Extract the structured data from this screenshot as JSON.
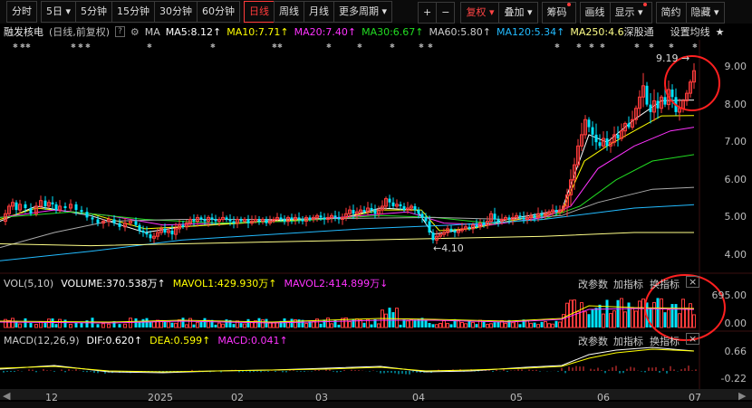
{
  "toolbar": {
    "periods": [
      "分时",
      "5日",
      "5分钟",
      "15分钟",
      "30分钟",
      "60分钟",
      "日线",
      "周线",
      "月线",
      "更多周期"
    ],
    "active": "日线",
    "right": [
      "+",
      "−",
      "复权",
      "叠加",
      "筹码",
      "画线",
      "显示",
      "简约",
      "隐藏"
    ]
  },
  "info": {
    "name": "融发核电",
    "mode": "(日线,前复权)",
    "help": "?",
    "ma_label": "MA",
    "ma5": "MA5:8.12↑",
    "ma10": "MA10:7.71↑",
    "ma20": "MA20:7.40↑",
    "ma30": "MA30:6.67↑",
    "ma60": "MA60:5.80↑",
    "ma120": "MA120:5.34↑",
    "ma250": "MA250:4.6",
    "deep": "深股通",
    "settings": "设置均线",
    "star": "★"
  },
  "vol": {
    "title": "VOL(5,10)",
    "volume": "VOLUME:370.538万↑",
    "mavol1": "MAVOL1:429.930万↑",
    "mavol2": "MAVOL2:414.899万↓",
    "btn1": "改参数",
    "btn2": "加指标",
    "btn3": "换指标",
    "close": "×"
  },
  "macd": {
    "title": "MACD(12,26,9)",
    "dif": "DIF:0.620↑",
    "dea": "DEA:0.599↑",
    "macd": "MACD:0.041↑",
    "btn1": "改参数",
    "btn2": "加指标",
    "btn3": "换指标",
    "close": "×"
  },
  "chart_data": {
    "type": "candlestick",
    "price_axis": {
      "ticks": [
        "9.00",
        "8.00",
        "7.00",
        "6.00",
        "5.00",
        "4.00"
      ],
      "range": [
        3.6,
        9.5
      ]
    },
    "vol_axis": {
      "ticks": [
        "695.00",
        "0.00"
      ]
    },
    "macd_axis": {
      "ticks": [
        "0.66",
        "-0.22"
      ]
    },
    "x_labels": [
      "12",
      "2025",
      "02",
      "03",
      "04",
      "05",
      "06",
      "07"
    ],
    "annotations": [
      {
        "text": "9.19",
        "price": 9.19
      },
      {
        "text": "4.10",
        "price": 4.1
      }
    ],
    "colors": {
      "up": "#ff3b3b",
      "down": "#00e5ff",
      "ma5": "#ffffff",
      "ma10": "#ffff00",
      "ma20": "#ff33ff",
      "ma30": "#22dd22",
      "ma60": "#aaaaaa",
      "ma120": "#22bbff",
      "ma250": "#ffff88",
      "circle": "#ff2020"
    },
    "price_path": [
      [
        0,
        4.9
      ],
      [
        6,
        5.1
      ],
      [
        10,
        5.3
      ],
      [
        14,
        5.4
      ],
      [
        18,
        5.2
      ],
      [
        22,
        5.35
      ],
      [
        28,
        5.25
      ],
      [
        34,
        5.1
      ],
      [
        40,
        5.3
      ],
      [
        45,
        5.45
      ],
      [
        50,
        5.3
      ],
      [
        54,
        5.4
      ],
      [
        58,
        5.35
      ],
      [
        62,
        5.2
      ],
      [
        66,
        5.3
      ],
      [
        72,
        5.25
      ],
      [
        78,
        5.35
      ],
      [
        84,
        5.2
      ],
      [
        90,
        5.15
      ],
      [
        96,
        5.0
      ],
      [
        102,
        4.95
      ],
      [
        108,
        4.85
      ],
      [
        114,
        4.9
      ],
      [
        120,
        4.95
      ],
      [
        126,
        4.85
      ],
      [
        132,
        4.75
      ],
      [
        138,
        4.85
      ],
      [
        144,
        4.9
      ],
      [
        150,
        4.8
      ],
      [
        154,
        4.65
      ],
      [
        158,
        4.6
      ],
      [
        162,
        4.55
      ],
      [
        166,
        4.45
      ],
      [
        170,
        4.5
      ],
      [
        174,
        4.6
      ],
      [
        178,
        4.7
      ],
      [
        182,
        4.6
      ],
      [
        186,
        4.65
      ],
      [
        190,
        4.55
      ],
      [
        194,
        4.7
      ],
      [
        198,
        4.8
      ],
      [
        202,
        4.75
      ],
      [
        206,
        4.85
      ],
      [
        210,
        4.95
      ],
      [
        214,
        4.9
      ],
      [
        218,
        5.0
      ],
      [
        222,
        4.95
      ],
      [
        226,
        4.9
      ],
      [
        230,
        5.0
      ],
      [
        234,
        4.95
      ],
      [
        238,
        4.9
      ],
      [
        242,
        4.95
      ],
      [
        246,
        5.0
      ],
      [
        250,
        4.95
      ],
      [
        254,
        4.9
      ],
      [
        258,
        4.85
      ],
      [
        262,
        4.95
      ],
      [
        266,
        4.9
      ],
      [
        270,
        4.95
      ],
      [
        274,
        4.85
      ],
      [
        278,
        4.9
      ],
      [
        282,
        4.95
      ],
      [
        286,
        4.9
      ],
      [
        290,
        4.95
      ],
      [
        294,
        4.85
      ],
      [
        298,
        4.9
      ],
      [
        302,
        4.95
      ],
      [
        306,
        5.0
      ],
      [
        310,
        4.95
      ],
      [
        314,
        4.9
      ],
      [
        318,
        5.0
      ],
      [
        322,
        4.95
      ],
      [
        326,
        5.0
      ],
      [
        330,
        4.95
      ],
      [
        334,
        4.9
      ],
      [
        338,
        5.0
      ],
      [
        342,
        4.95
      ],
      [
        346,
        5.0
      ],
      [
        350,
        5.05
      ],
      [
        354,
        5.0
      ],
      [
        358,
        4.95
      ],
      [
        362,
        5.0
      ],
      [
        366,
        5.05
      ],
      [
        370,
        5.0
      ],
      [
        374,
        4.95
      ],
      [
        378,
        5.0
      ],
      [
        382,
        5.1
      ],
      [
        386,
        5.2
      ],
      [
        390,
        5.1
      ],
      [
        394,
        5.15
      ],
      [
        398,
        5.2
      ],
      [
        402,
        5.15
      ],
      [
        406,
        5.25
      ],
      [
        410,
        5.2
      ],
      [
        414,
        5.1
      ],
      [
        418,
        5.2
      ],
      [
        422,
        5.3
      ],
      [
        426,
        5.5
      ],
      [
        430,
        5.4
      ],
      [
        434,
        5.3
      ],
      [
        438,
        5.35
      ],
      [
        442,
        5.3
      ],
      [
        446,
        5.2
      ],
      [
        450,
        5.25
      ],
      [
        454,
        5.3
      ],
      [
        458,
        5.2
      ],
      [
        462,
        5.1
      ],
      [
        466,
        5.0
      ],
      [
        470,
        4.9
      ],
      [
        474,
        4.6
      ],
      [
        478,
        4.4
      ],
      [
        482,
        4.5
      ],
      [
        486,
        4.55
      ],
      [
        490,
        4.6
      ],
      [
        494,
        4.7
      ],
      [
        498,
        4.65
      ],
      [
        502,
        4.6
      ],
      [
        506,
        4.65
      ],
      [
        510,
        4.7
      ],
      [
        514,
        4.75
      ],
      [
        518,
        4.7
      ],
      [
        522,
        4.8
      ],
      [
        526,
        4.75
      ],
      [
        530,
        4.85
      ],
      [
        534,
        4.8
      ],
      [
        538,
        4.9
      ],
      [
        542,
        5.1
      ],
      [
        546,
        4.95
      ],
      [
        550,
        4.9
      ],
      [
        554,
        4.95
      ],
      [
        558,
        5.0
      ],
      [
        562,
        4.95
      ],
      [
        566,
        5.0
      ],
      [
        570,
        5.05
      ],
      [
        574,
        5.0
      ],
      [
        578,
        4.95
      ],
      [
        582,
        5.0
      ],
      [
        586,
        5.05
      ],
      [
        590,
        5.0
      ],
      [
        594,
        5.1
      ],
      [
        598,
        5.05
      ],
      [
        602,
        5.1
      ],
      [
        606,
        5.15
      ],
      [
        610,
        5.2
      ],
      [
        614,
        5.15
      ],
      [
        618,
        5.2
      ],
      [
        622,
        5.3
      ],
      [
        626,
        5.6
      ],
      [
        630,
        6.0
      ],
      [
        634,
        6.4
      ],
      [
        638,
        6.9
      ],
      [
        642,
        7.2
      ],
      [
        646,
        7.6
      ],
      [
        650,
        7.4
      ],
      [
        654,
        7.2
      ],
      [
        658,
        7.0
      ],
      [
        662,
        6.9
      ],
      [
        666,
        7.1
      ],
      [
        670,
        6.9
      ],
      [
        674,
        7.0
      ],
      [
        678,
        7.2
      ],
      [
        682,
        7.1
      ],
      [
        686,
        7.3
      ],
      [
        690,
        7.5
      ],
      [
        694,
        7.4
      ],
      [
        698,
        7.6
      ],
      [
        702,
        7.9
      ],
      [
        706,
        8.2
      ],
      [
        710,
        8.5
      ],
      [
        714,
        8.0
      ],
      [
        718,
        7.8
      ],
      [
        722,
        8.1
      ],
      [
        726,
        7.9
      ],
      [
        730,
        8.2
      ],
      [
        734,
        8.0
      ],
      [
        738,
        8.4
      ],
      [
        742,
        8.2
      ],
      [
        746,
        7.8
      ],
      [
        750,
        7.9
      ],
      [
        754,
        8.1
      ],
      [
        758,
        8.3
      ],
      [
        762,
        8.6
      ],
      [
        766,
        8.9
      ]
    ],
    "ma_paths": {
      "ma5": [
        [
          0,
          4.9
        ],
        [
          40,
          5.3
        ],
        [
          100,
          5.05
        ],
        [
          160,
          4.6
        ],
        [
          200,
          4.75
        ],
        [
          300,
          4.92
        ],
        [
          380,
          5.0
        ],
        [
          420,
          5.25
        ],
        [
          460,
          5.2
        ],
        [
          478,
          4.55
        ],
        [
          520,
          4.72
        ],
        [
          560,
          4.95
        ],
        [
          620,
          5.2
        ],
        [
          650,
          7.2
        ],
        [
          670,
          7.0
        ],
        [
          700,
          7.6
        ],
        [
          730,
          8.1
        ],
        [
          766,
          8.12
        ]
      ],
      "ma10": [
        [
          0,
          4.95
        ],
        [
          40,
          5.25
        ],
        [
          100,
          5.1
        ],
        [
          160,
          4.7
        ],
        [
          200,
          4.75
        ],
        [
          300,
          4.9
        ],
        [
          380,
          5.0
        ],
        [
          420,
          5.2
        ],
        [
          465,
          5.2
        ],
        [
          485,
          4.65
        ],
        [
          520,
          4.7
        ],
        [
          560,
          4.9
        ],
        [
          620,
          5.15
        ],
        [
          645,
          6.5
        ],
        [
          670,
          6.9
        ],
        [
          700,
          7.3
        ],
        [
          730,
          7.7
        ],
        [
          766,
          7.71
        ]
      ],
      "ma20": [
        [
          0,
          5.0
        ],
        [
          60,
          5.2
        ],
        [
          120,
          5.05
        ],
        [
          180,
          4.8
        ],
        [
          240,
          4.85
        ],
        [
          320,
          4.9
        ],
        [
          400,
          5.05
        ],
        [
          450,
          5.15
        ],
        [
          490,
          4.85
        ],
        [
          540,
          4.8
        ],
        [
          600,
          5.0
        ],
        [
          630,
          5.3
        ],
        [
          660,
          6.3
        ],
        [
          700,
          6.9
        ],
        [
          740,
          7.3
        ],
        [
          766,
          7.4
        ]
      ],
      "ma30": [
        [
          0,
          5.0
        ],
        [
          80,
          5.15
        ],
        [
          160,
          4.95
        ],
        [
          240,
          4.85
        ],
        [
          320,
          4.9
        ],
        [
          420,
          5.05
        ],
        [
          480,
          5.0
        ],
        [
          540,
          4.85
        ],
        [
          600,
          4.95
        ],
        [
          640,
          5.3
        ],
        [
          680,
          6.0
        ],
        [
          720,
          6.5
        ],
        [
          766,
          6.67
        ]
      ],
      "ma60": [
        [
          0,
          4.2
        ],
        [
          60,
          4.6
        ],
        [
          120,
          4.9
        ],
        [
          200,
          4.95
        ],
        [
          300,
          4.95
        ],
        [
          400,
          4.98
        ],
        [
          480,
          5.0
        ],
        [
          560,
          4.95
        ],
        [
          620,
          5.05
        ],
        [
          660,
          5.4
        ],
        [
          720,
          5.75
        ],
        [
          766,
          5.8
        ]
      ],
      "ma120": [
        [
          0,
          3.85
        ],
        [
          100,
          4.1
        ],
        [
          200,
          4.4
        ],
        [
          300,
          4.55
        ],
        [
          400,
          4.7
        ],
        [
          500,
          4.8
        ],
        [
          600,
          4.95
        ],
        [
          700,
          5.25
        ],
        [
          766,
          5.34
        ]
      ],
      "ma250": [
        [
          0,
          4.3
        ],
        [
          100,
          4.25
        ],
        [
          200,
          4.3
        ],
        [
          300,
          4.35
        ],
        [
          400,
          4.4
        ],
        [
          500,
          4.45
        ],
        [
          600,
          4.5
        ],
        [
          700,
          4.6
        ],
        [
          766,
          4.6
        ]
      ]
    }
  }
}
